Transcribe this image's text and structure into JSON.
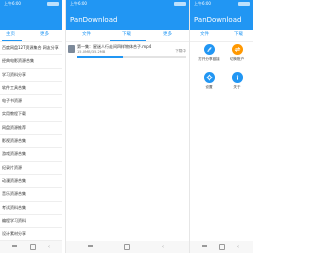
{
  "screens": [
    {
      "status_time": "上午6:00",
      "tabs": [
        {
          "label": "主页"
        },
        {
          "label": "更多"
        }
      ],
      "list_items": [
        "百度网盘12T资源集合 网友分享",
        "经典电影资源合集",
        "学习资料分享",
        "软件工具合集",
        "电子书资源",
        "实用教程下载",
        "网盘资源推荐",
        "影视资源合集",
        "游戏资源合集",
        "纪录片资源",
        "动漫资源合集",
        "音乐资源合集",
        "考试资料合集",
        "编程学习资料",
        "设计素材分享",
        "办公软件合集"
      ]
    },
    {
      "status_time": "上午6:00",
      "app_title": "PanDownload",
      "tabs": [
        {
          "label": "文件"
        },
        {
          "label": "下载"
        },
        {
          "label": "更多"
        }
      ],
      "download": {
        "title": "第一集：星迷人行走间四样物体合子.mp4",
        "size": "15.0MB/35.2MB",
        "status": "下载中",
        "progress": 0.42
      }
    },
    {
      "status_time": "上午6:00",
      "app_title": "PanDownload",
      "tabs": [
        {
          "label": "文件"
        },
        {
          "label": "下载"
        }
      ],
      "tiles": [
        {
          "label": "打开分享链接",
          "icon": "link-icon",
          "color": "#2196f3"
        },
        {
          "label": "切换账户",
          "icon": "swap-icon",
          "color": "#ff9800"
        },
        {
          "label": "设置",
          "icon": "gear-icon",
          "color": "#2196f3"
        },
        {
          "label": "关于",
          "icon": "info-icon",
          "color": "#2196f3"
        }
      ]
    }
  ],
  "colors": {
    "primary": "#2196f3",
    "accent": "#ff9800"
  }
}
